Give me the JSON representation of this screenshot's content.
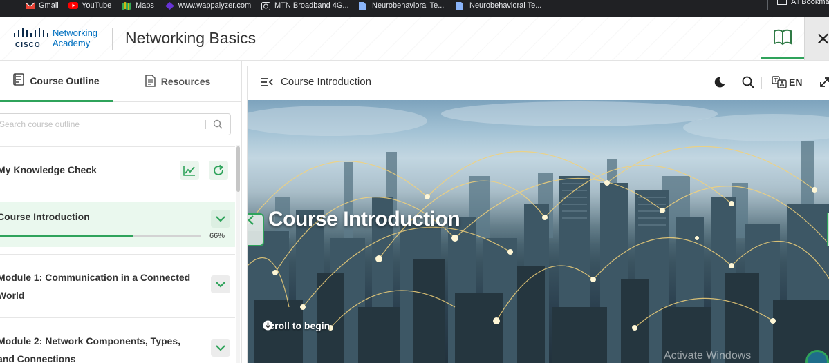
{
  "bookmarks": {
    "items": [
      {
        "label": "Gmail",
        "icon": "gmail-icon",
        "color": "#ea4335"
      },
      {
        "label": "YouTube",
        "icon": "youtube-icon",
        "color": "#ff0000"
      },
      {
        "label": "Maps",
        "icon": "maps-icon",
        "color": "#34a853"
      },
      {
        "label": "www.wappalyzer.com",
        "icon": "wappalyzer-icon",
        "color": "#6733d5"
      },
      {
        "label": "MTN Broadband 4G...",
        "icon": "router-icon",
        "color": "#e8eaed"
      },
      {
        "label": "Neurobehavioral Te...",
        "icon": "doc-icon",
        "color": "#8ab4f8"
      },
      {
        "label": "Neurobehavioral Te...",
        "icon": "doc-icon",
        "color": "#8ab4f8"
      }
    ],
    "all_label": "All Bookmarks"
  },
  "header": {
    "logo_brand": "CISCO",
    "logo_line1": "Networking",
    "logo_line2": "Academy",
    "title": "Networking Basics"
  },
  "sidebar": {
    "tabs": [
      {
        "label": "Course Outline",
        "icon": "outline-icon",
        "active": true
      },
      {
        "label": "Resources",
        "icon": "document-icon",
        "active": false
      }
    ],
    "search_placeholder": "Search course outline",
    "knowledge_check": {
      "label": "My Knowledge Check"
    },
    "course_intro": {
      "label": "Course Introduction",
      "progress": 0.66,
      "progress_label": "66%"
    },
    "module1": {
      "label": "Module 1: Communication in a Connected World"
    },
    "module2": {
      "label": "Module 2: Network Components, Types, and Connections"
    }
  },
  "content": {
    "breadcrumb": "Course Introduction",
    "language": "EN",
    "hero_title": "Course Introduction",
    "scroll_label": "Scroll to begin",
    "watermark": "Activate Windows"
  },
  "colors": {
    "accent": "#2fa35b",
    "brand_blue": "#0070c0"
  }
}
